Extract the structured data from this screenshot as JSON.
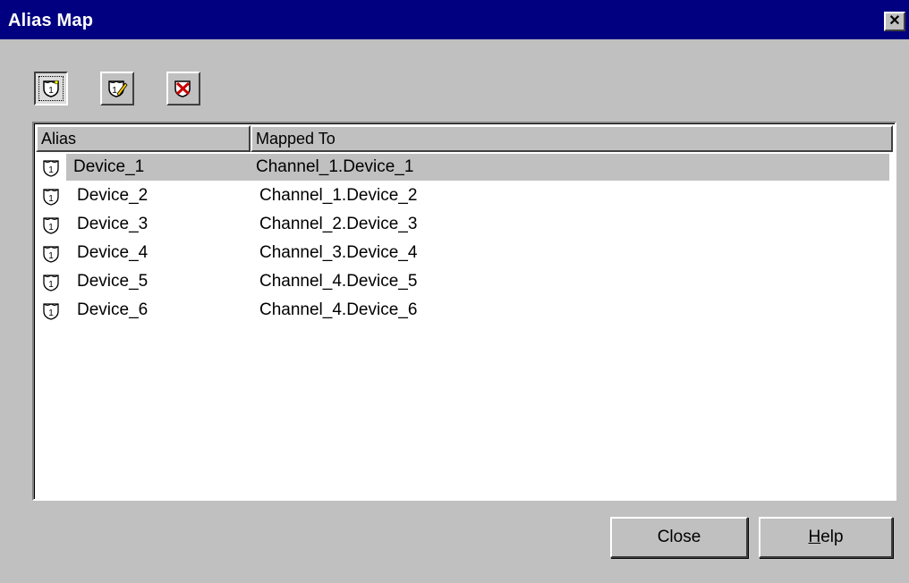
{
  "window": {
    "title": "Alias Map",
    "close_glyph": "✕"
  },
  "toolbar": {
    "buttons": [
      {
        "icon": "new-alias-icon",
        "pressed": true
      },
      {
        "icon": "edit-alias-icon",
        "pressed": false
      },
      {
        "icon": "delete-alias-icon",
        "pressed": false
      }
    ]
  },
  "table": {
    "columns": [
      "Alias",
      "Mapped To"
    ],
    "rows": [
      {
        "alias": "Device_1",
        "mapped_to": "Channel_1.Device_1",
        "selected": true
      },
      {
        "alias": "Device_2",
        "mapped_to": "Channel_1.Device_2",
        "selected": false
      },
      {
        "alias": "Device_3",
        "mapped_to": "Channel_2.Device_3",
        "selected": false
      },
      {
        "alias": "Device_4",
        "mapped_to": "Channel_3.Device_4",
        "selected": false
      },
      {
        "alias": "Device_5",
        "mapped_to": "Channel_4.Device_5",
        "selected": false
      },
      {
        "alias": "Device_6",
        "mapped_to": "Channel_4.Device_6",
        "selected": false
      }
    ]
  },
  "buttons": {
    "close_label": "Close",
    "help_mnemonic": "H",
    "help_rest": "elp"
  },
  "colors": {
    "titlebar": "#000080",
    "face": "#c0c0c0",
    "selection": "#c0c0c0"
  }
}
